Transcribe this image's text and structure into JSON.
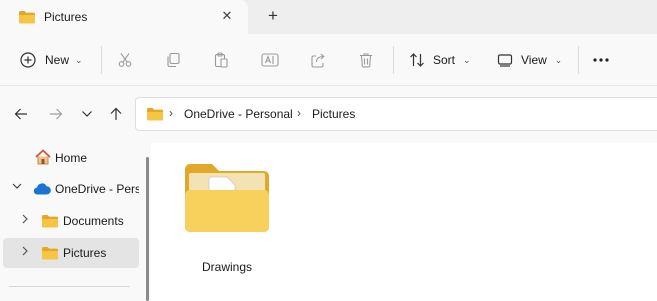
{
  "tab": {
    "title": "Pictures",
    "folder_icon": "folder-icon",
    "close_icon": "close-icon"
  },
  "new_tab_icon": "plus-icon",
  "toolbar": {
    "new_label": "New",
    "sort_label": "Sort",
    "view_label": "View",
    "icons": [
      "plus-circle-icon",
      "cut-icon",
      "copy-icon",
      "paste-icon",
      "rename-icon",
      "share-icon",
      "delete-icon",
      "sort-icon",
      "view-icon",
      "more-icon"
    ]
  },
  "nav": {
    "back_icon": "arrow-left-icon",
    "forward_icon": "arrow-right-icon",
    "recent_icon": "chevron-down-icon",
    "up_icon": "arrow-up-icon"
  },
  "address": {
    "crumbs": [
      "OneDrive - Personal",
      "Pictures"
    ],
    "separator": "›"
  },
  "tree": {
    "items": [
      {
        "label": "Home",
        "icon": "home-icon"
      },
      {
        "label": "OneDrive - Personal",
        "icon": "cloud-icon",
        "expanded": true
      },
      {
        "label": "Documents",
        "icon": "folder-icon",
        "expanded": false
      },
      {
        "label": "Pictures",
        "icon": "folder-icon",
        "expanded": false,
        "selected": true
      }
    ]
  },
  "content": {
    "items": [
      {
        "label": "Drawings",
        "icon": "folder-with-image-icon"
      }
    ]
  },
  "colors": {
    "folder": "#f6c543",
    "folder_dark": "#e2a828",
    "cloud": "#1a73d1",
    "home_roof": "#d2563c",
    "selected": "#e4e4e4"
  }
}
